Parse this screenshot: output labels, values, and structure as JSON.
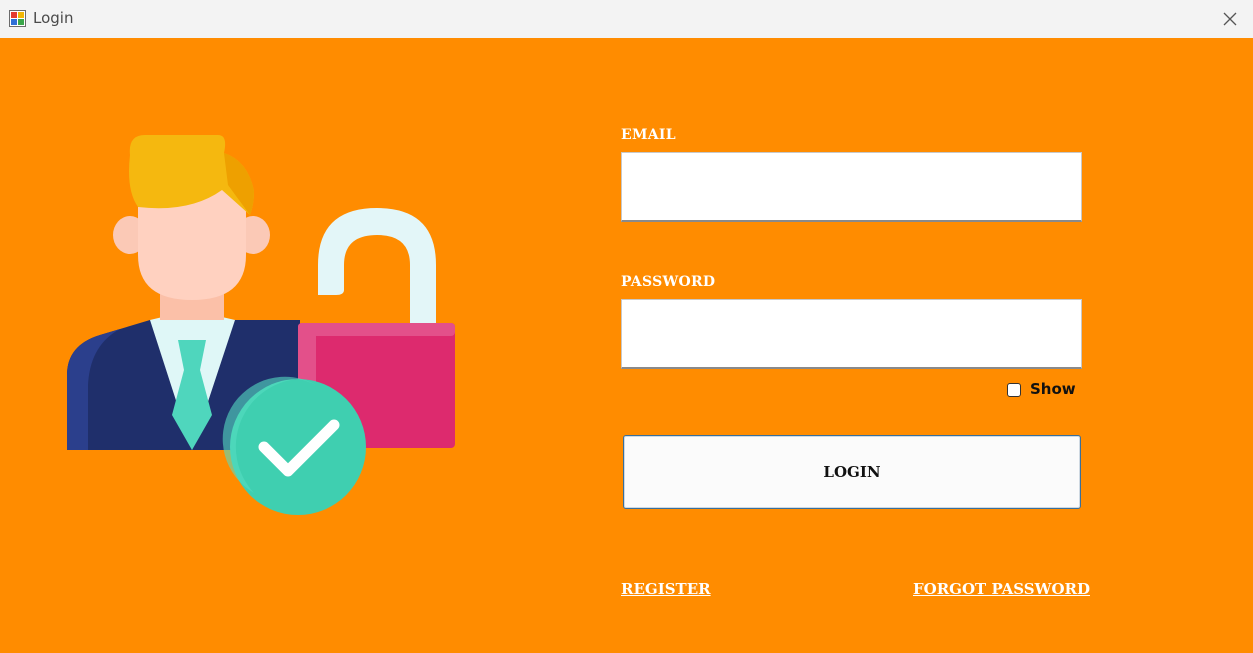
{
  "window": {
    "title": "Login"
  },
  "form": {
    "email_label": "EMAIL",
    "email_value": "",
    "password_label": "PASSWORD",
    "password_value": "",
    "show_label": "Show",
    "show_checked": false,
    "login_button": "LOGIN",
    "register_link": "REGISTER",
    "forgot_link": "FORGOT PASSWORD"
  },
  "colors": {
    "background": "#ff8c00",
    "titlebar": "#f3f3f3",
    "hair": "#f5b80f",
    "suit": "#1f2f6b",
    "tie": "#4fd6bd",
    "lock_body": "#dd2a6e",
    "check_badge": "#3fcfb0"
  },
  "icons": {
    "app": "app-window-icon",
    "close": "close-icon",
    "illustration": "user-unlock-illustration"
  }
}
